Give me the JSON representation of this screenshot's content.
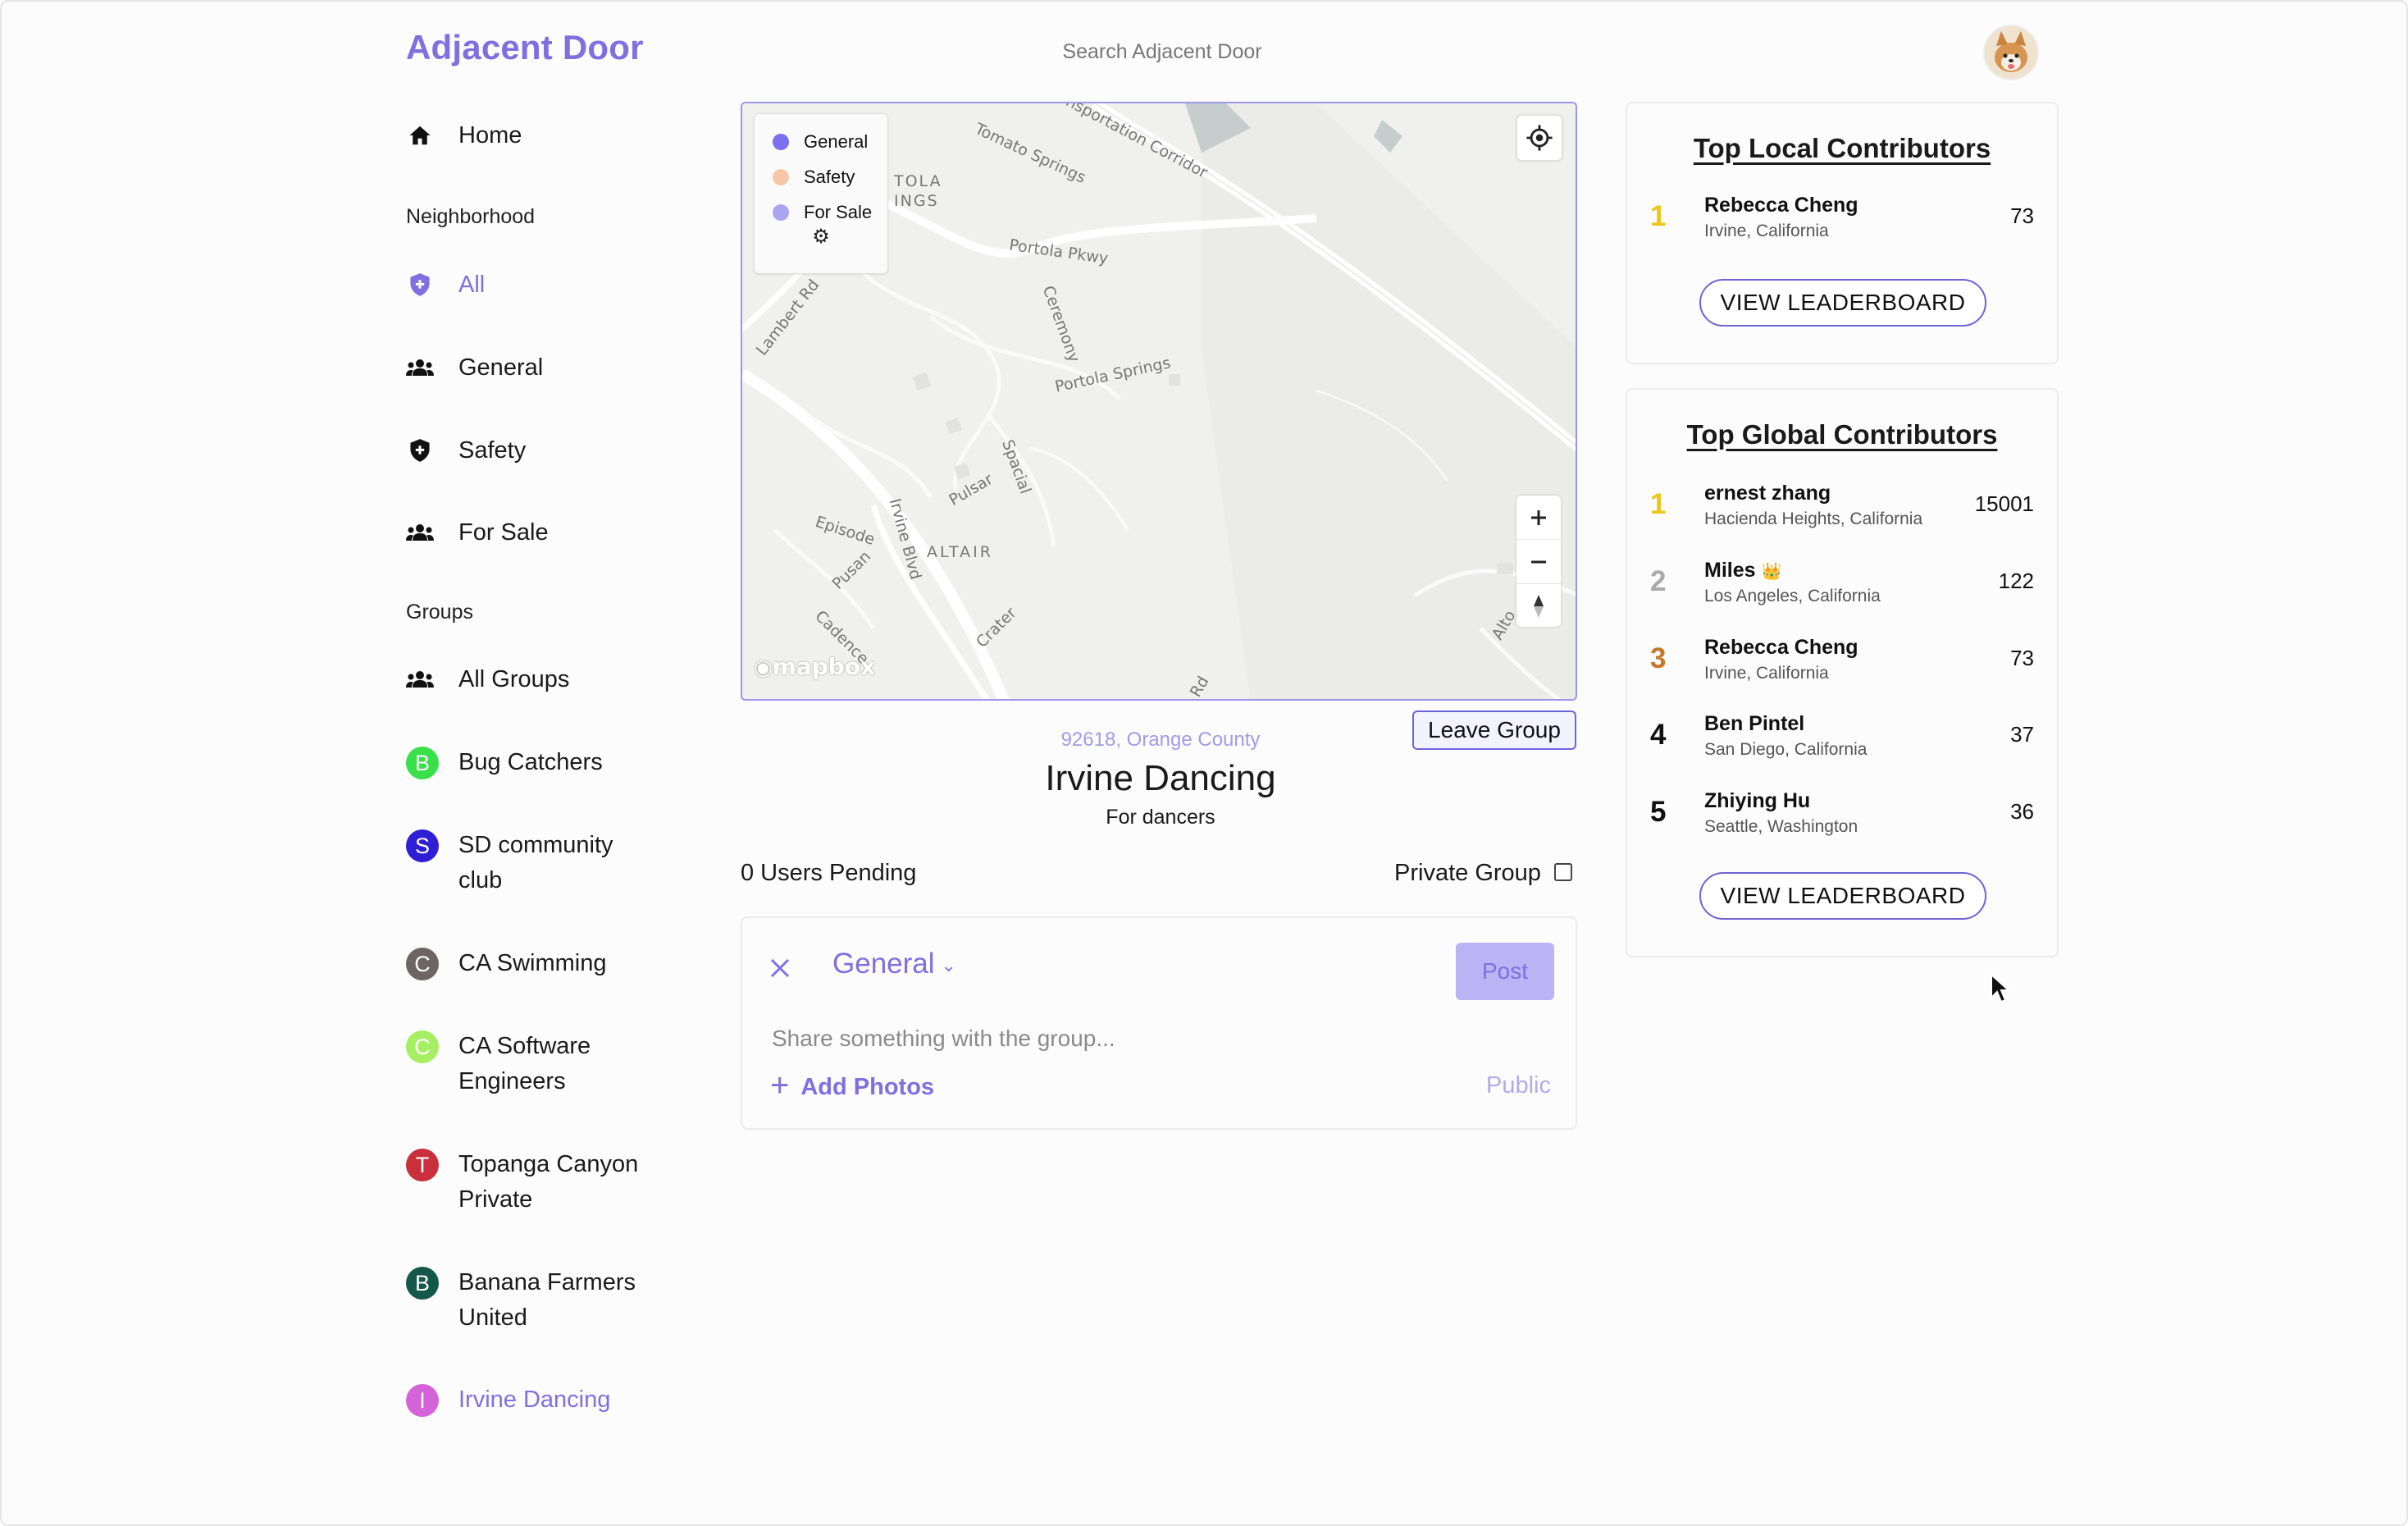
{
  "app": {
    "title": "Adjacent Door"
  },
  "search": {
    "placeholder": "Search Adjacent Door"
  },
  "sidebar": {
    "home_label": "Home",
    "neighborhood_label": "Neighborhood",
    "neighborhood_items": [
      {
        "label": "All",
        "icon": "shield-plus-icon",
        "active": true
      },
      {
        "label": "General",
        "icon": "people-icon"
      },
      {
        "label": "Safety",
        "icon": "shield-plus-icon"
      },
      {
        "label": "For Sale",
        "icon": "people-icon"
      }
    ],
    "groups_label": "Groups",
    "all_groups_label": "All Groups",
    "groups": [
      {
        "initial": "B",
        "label": "Bug Catchers",
        "color": "#39e04a"
      },
      {
        "initial": "S",
        "label": "SD community club",
        "color": "#2e1fd6"
      },
      {
        "initial": "C",
        "label": "CA Swimming",
        "color": "#6d6464"
      },
      {
        "initial": "C",
        "label": "CA Software Engineers",
        "color": "#a6ef63"
      },
      {
        "initial": "T",
        "label": "Topanga Canyon Private",
        "color": "#c9303c"
      },
      {
        "initial": "B",
        "label": "Banana Farmers United",
        "color": "#14584a"
      },
      {
        "initial": "I",
        "label": "Irvine Dancing",
        "color": "#d463d9",
        "active": true
      }
    ]
  },
  "map": {
    "legend": [
      {
        "label": "General",
        "color": "#7b6ff0"
      },
      {
        "label": "Safety",
        "color": "#f7c8a8"
      },
      {
        "label": "For Sale",
        "color": "#a8a6f3"
      }
    ],
    "street_labels": {
      "transport": "nsportation Corridor",
      "tomato": "Tomato Springs",
      "tola": "TOLA",
      "ings": "INGS",
      "portola_pkwy": "Portola Pkwy",
      "lambert": "Lambert Rd",
      "ceremony": "Ceremony",
      "portola_springs": "Portola Springs",
      "spacial": "Spacial",
      "pulsar": "Pulsar",
      "episode": "Episode",
      "irvine_blvd": "Irvine Blvd",
      "pusan": "Pusan",
      "altair": "ALTAIR",
      "cadence": "Cadence",
      "crater": "Crater",
      "alton": "Alto",
      "rd": "Rd"
    },
    "attribution": "mapbox"
  },
  "group": {
    "location": "92618, Orange County",
    "title": "Irvine Dancing",
    "description": "For dancers",
    "leave_label": "Leave Group",
    "pending": "0 Users Pending",
    "private_label": "Private Group"
  },
  "composer": {
    "category": "General",
    "post_label": "Post",
    "placeholder": "Share something with the group...",
    "add_photos": "Add Photos",
    "visibility": "Public"
  },
  "local": {
    "title": "Top Local Contributors",
    "contributors": [
      {
        "rank": "1",
        "name": "Rebecca Cheng",
        "place": "Irvine, California",
        "score": "73",
        "rank_color": "#f0c419"
      }
    ],
    "button": "VIEW LEADERBOARD"
  },
  "global": {
    "title": "Top Global Contributors",
    "contributors": [
      {
        "rank": "1",
        "name": "ernest zhang",
        "place": "Hacienda Heights, California",
        "score": "15001",
        "rank_color": "#f0c419"
      },
      {
        "rank": "2",
        "name": "Miles",
        "badge": "👑",
        "place": "Los Angeles, California",
        "score": "122",
        "rank_color": "#a9a9a9"
      },
      {
        "rank": "3",
        "name": "Rebecca Cheng",
        "place": "Irvine, California",
        "score": "73",
        "rank_color": "#c5772c"
      },
      {
        "rank": "4",
        "name": "Ben Pintel",
        "place": "San Diego, California",
        "score": "37",
        "rank_color": "#111111"
      },
      {
        "rank": "5",
        "name": "Zhiying Hu",
        "place": "Seattle, Washington",
        "score": "36",
        "rank_color": "#111111"
      }
    ],
    "button": "VIEW LEADERBOARD"
  }
}
